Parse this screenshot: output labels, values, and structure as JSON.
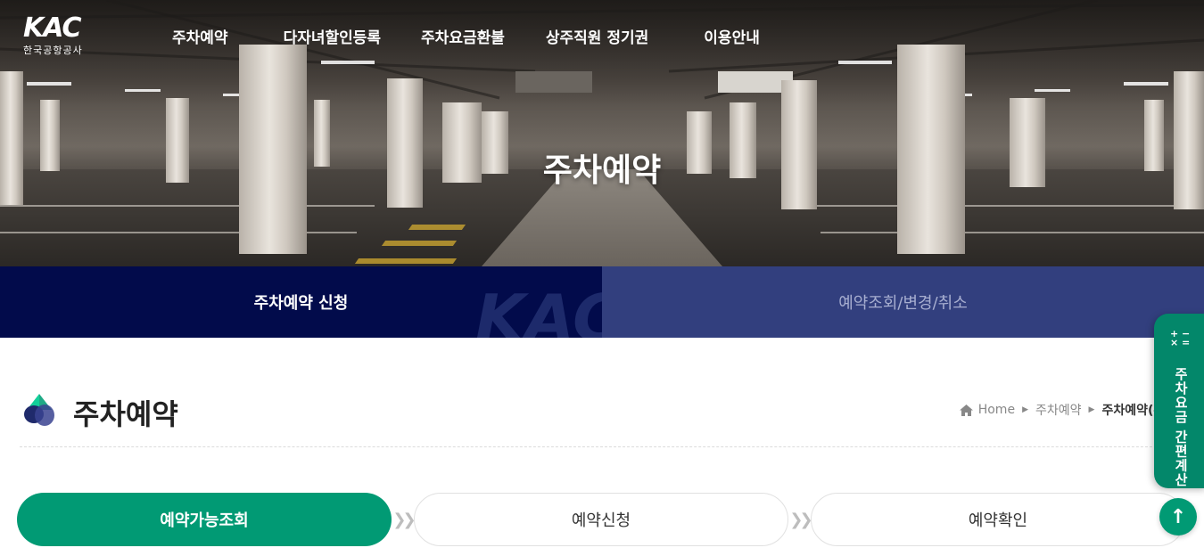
{
  "header": {
    "logo_mark": "KAC",
    "logo_sub": "한국공항공사",
    "nav": [
      "주차예약",
      "다자녀할인등록",
      "주차요금환불",
      "상주직원 정기권",
      "이용안내"
    ]
  },
  "hero": {
    "title": "주차예약"
  },
  "tabs": {
    "apply": "주차예약 신청",
    "lookup": "예약조회/변경/취소",
    "watermark": "KAC"
  },
  "page": {
    "title": "주차예약",
    "breadcrumb": {
      "home": "Home",
      "level1": "주차예약",
      "current": "주차예약(주차조"
    }
  },
  "steps": [
    {
      "label": "예약가능조회",
      "state": "active"
    },
    {
      "label": "예약신청",
      "state": "pending"
    },
    {
      "label": "예약확인",
      "state": "pending"
    }
  ],
  "floating": {
    "calc_label": "주차요금 간편계산",
    "calc_icon": "calculator-icon",
    "top_icon": "arrow-up-icon"
  },
  "colors": {
    "primary_green": "#019a74",
    "navy": "#020b4b",
    "tab_inactive": "#323f7e"
  }
}
